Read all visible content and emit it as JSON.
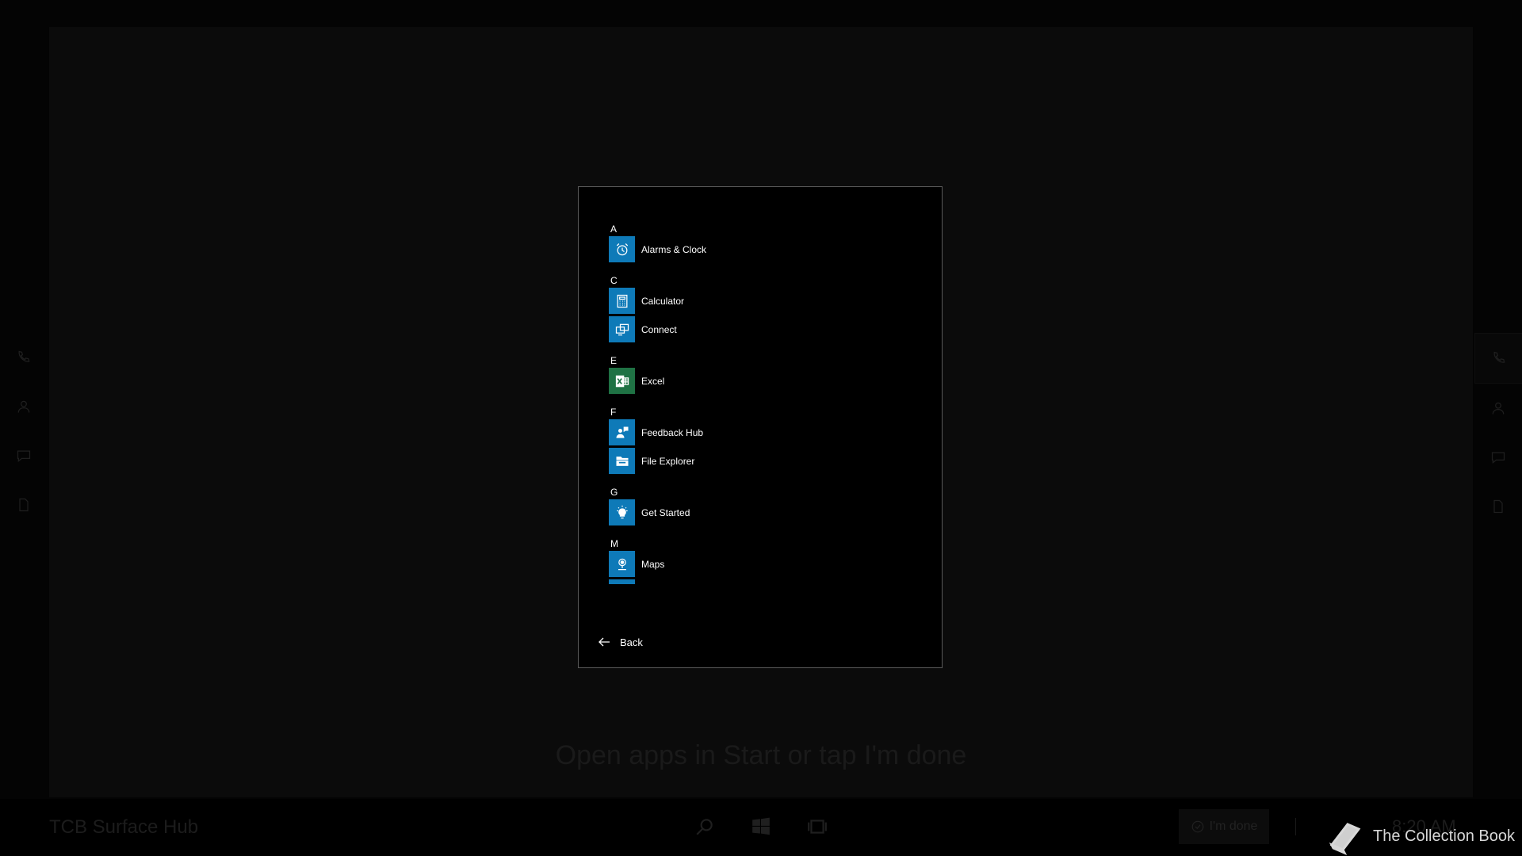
{
  "background": {
    "hint": "Open apps in Start or tap I'm done"
  },
  "taskbar": {
    "device_name": "TCB Surface Hub",
    "im_done_label": "I'm done",
    "clock": "8:20 AM",
    "icons": [
      "search-icon",
      "windows-start-icon",
      "task-view-icon",
      "checkmark-circle-icon"
    ]
  },
  "side_rail": {
    "icons": [
      "phone-icon",
      "person-icon",
      "chat-icon",
      "document-icon"
    ]
  },
  "watermark": {
    "text": "The Collection Book",
    "icon": "book-icon"
  },
  "start_menu": {
    "groups": [
      {
        "letter": "A",
        "apps": [
          {
            "label": "Alarms & Clock",
            "icon": "alarm-clock-icon",
            "color": "#0e7ab8"
          }
        ]
      },
      {
        "letter": "C",
        "apps": [
          {
            "label": "Calculator",
            "icon": "calculator-icon",
            "color": "#0e7ab8"
          },
          {
            "label": "Connect",
            "icon": "connect-icon",
            "color": "#0e7ab8"
          }
        ]
      },
      {
        "letter": "E",
        "apps": [
          {
            "label": "Excel",
            "icon": "excel-icon",
            "color": "#1f7244"
          }
        ]
      },
      {
        "letter": "F",
        "apps": [
          {
            "label": "Feedback Hub",
            "icon": "feedback-hub-icon",
            "color": "#0e7ab8"
          },
          {
            "label": "File Explorer",
            "icon": "file-explorer-icon",
            "color": "#0e7ab8"
          }
        ]
      },
      {
        "letter": "G",
        "apps": [
          {
            "label": "Get Started",
            "icon": "lightbulb-icon",
            "color": "#0e7ab8"
          }
        ]
      },
      {
        "letter": "M",
        "apps": [
          {
            "label": "Maps",
            "icon": "maps-icon",
            "color": "#0e7ab8"
          }
        ]
      }
    ],
    "back_label": "Back"
  }
}
